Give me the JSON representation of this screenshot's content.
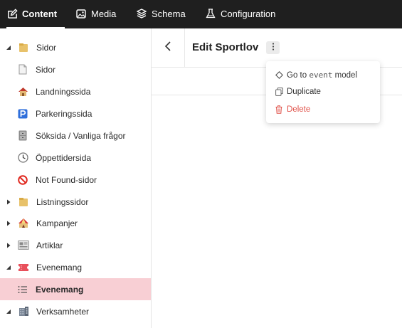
{
  "nav": {
    "tabs": [
      {
        "label": "Content",
        "icon": "edit-icon",
        "active": true
      },
      {
        "label": "Media",
        "icon": "image-icon"
      },
      {
        "label": "Schema",
        "icon": "layers-icon"
      },
      {
        "label": "Configuration",
        "icon": "flask-icon"
      }
    ]
  },
  "sidebar": {
    "items": [
      {
        "label": "Sidor",
        "icon": "folder-icon",
        "expanded": true
      },
      {
        "label": "Sidor",
        "icon": "page-icon"
      },
      {
        "label": "Landningssida",
        "icon": "house-icon"
      },
      {
        "label": "Parkeringssida",
        "icon": "parking-icon"
      },
      {
        "label": "Söksida / Vanliga frågor",
        "icon": "file-cabinet-icon"
      },
      {
        "label": "Öppettidersida",
        "icon": "clock-icon"
      },
      {
        "label": "Not Found-sidor",
        "icon": "prohibited-icon"
      },
      {
        "label": "Listningssidor",
        "icon": "folder-icon",
        "expanded": false
      },
      {
        "label": "Kampanjer",
        "icon": "circus-tent-icon",
        "expanded": false
      },
      {
        "label": "Artiklar",
        "icon": "newspaper-icon",
        "expanded": false
      },
      {
        "label": "Evenemang",
        "icon": "ticket-icon",
        "expanded": true
      },
      {
        "label": "Evenemang",
        "icon": "list-icon",
        "selected": true
      },
      {
        "label": "Verksamheter",
        "icon": "office-building-icon",
        "expanded": true
      }
    ]
  },
  "main": {
    "title": "Edit Sportlov",
    "menu": {
      "goto_prefix": "Go to",
      "goto_model": "event",
      "goto_suffix": "model",
      "duplicate": "Duplicate",
      "delete": "Delete"
    }
  },
  "colors": {
    "topbar": "#1f1f1f",
    "selected_row": "#f8cfd4",
    "danger": "#e0524a"
  }
}
